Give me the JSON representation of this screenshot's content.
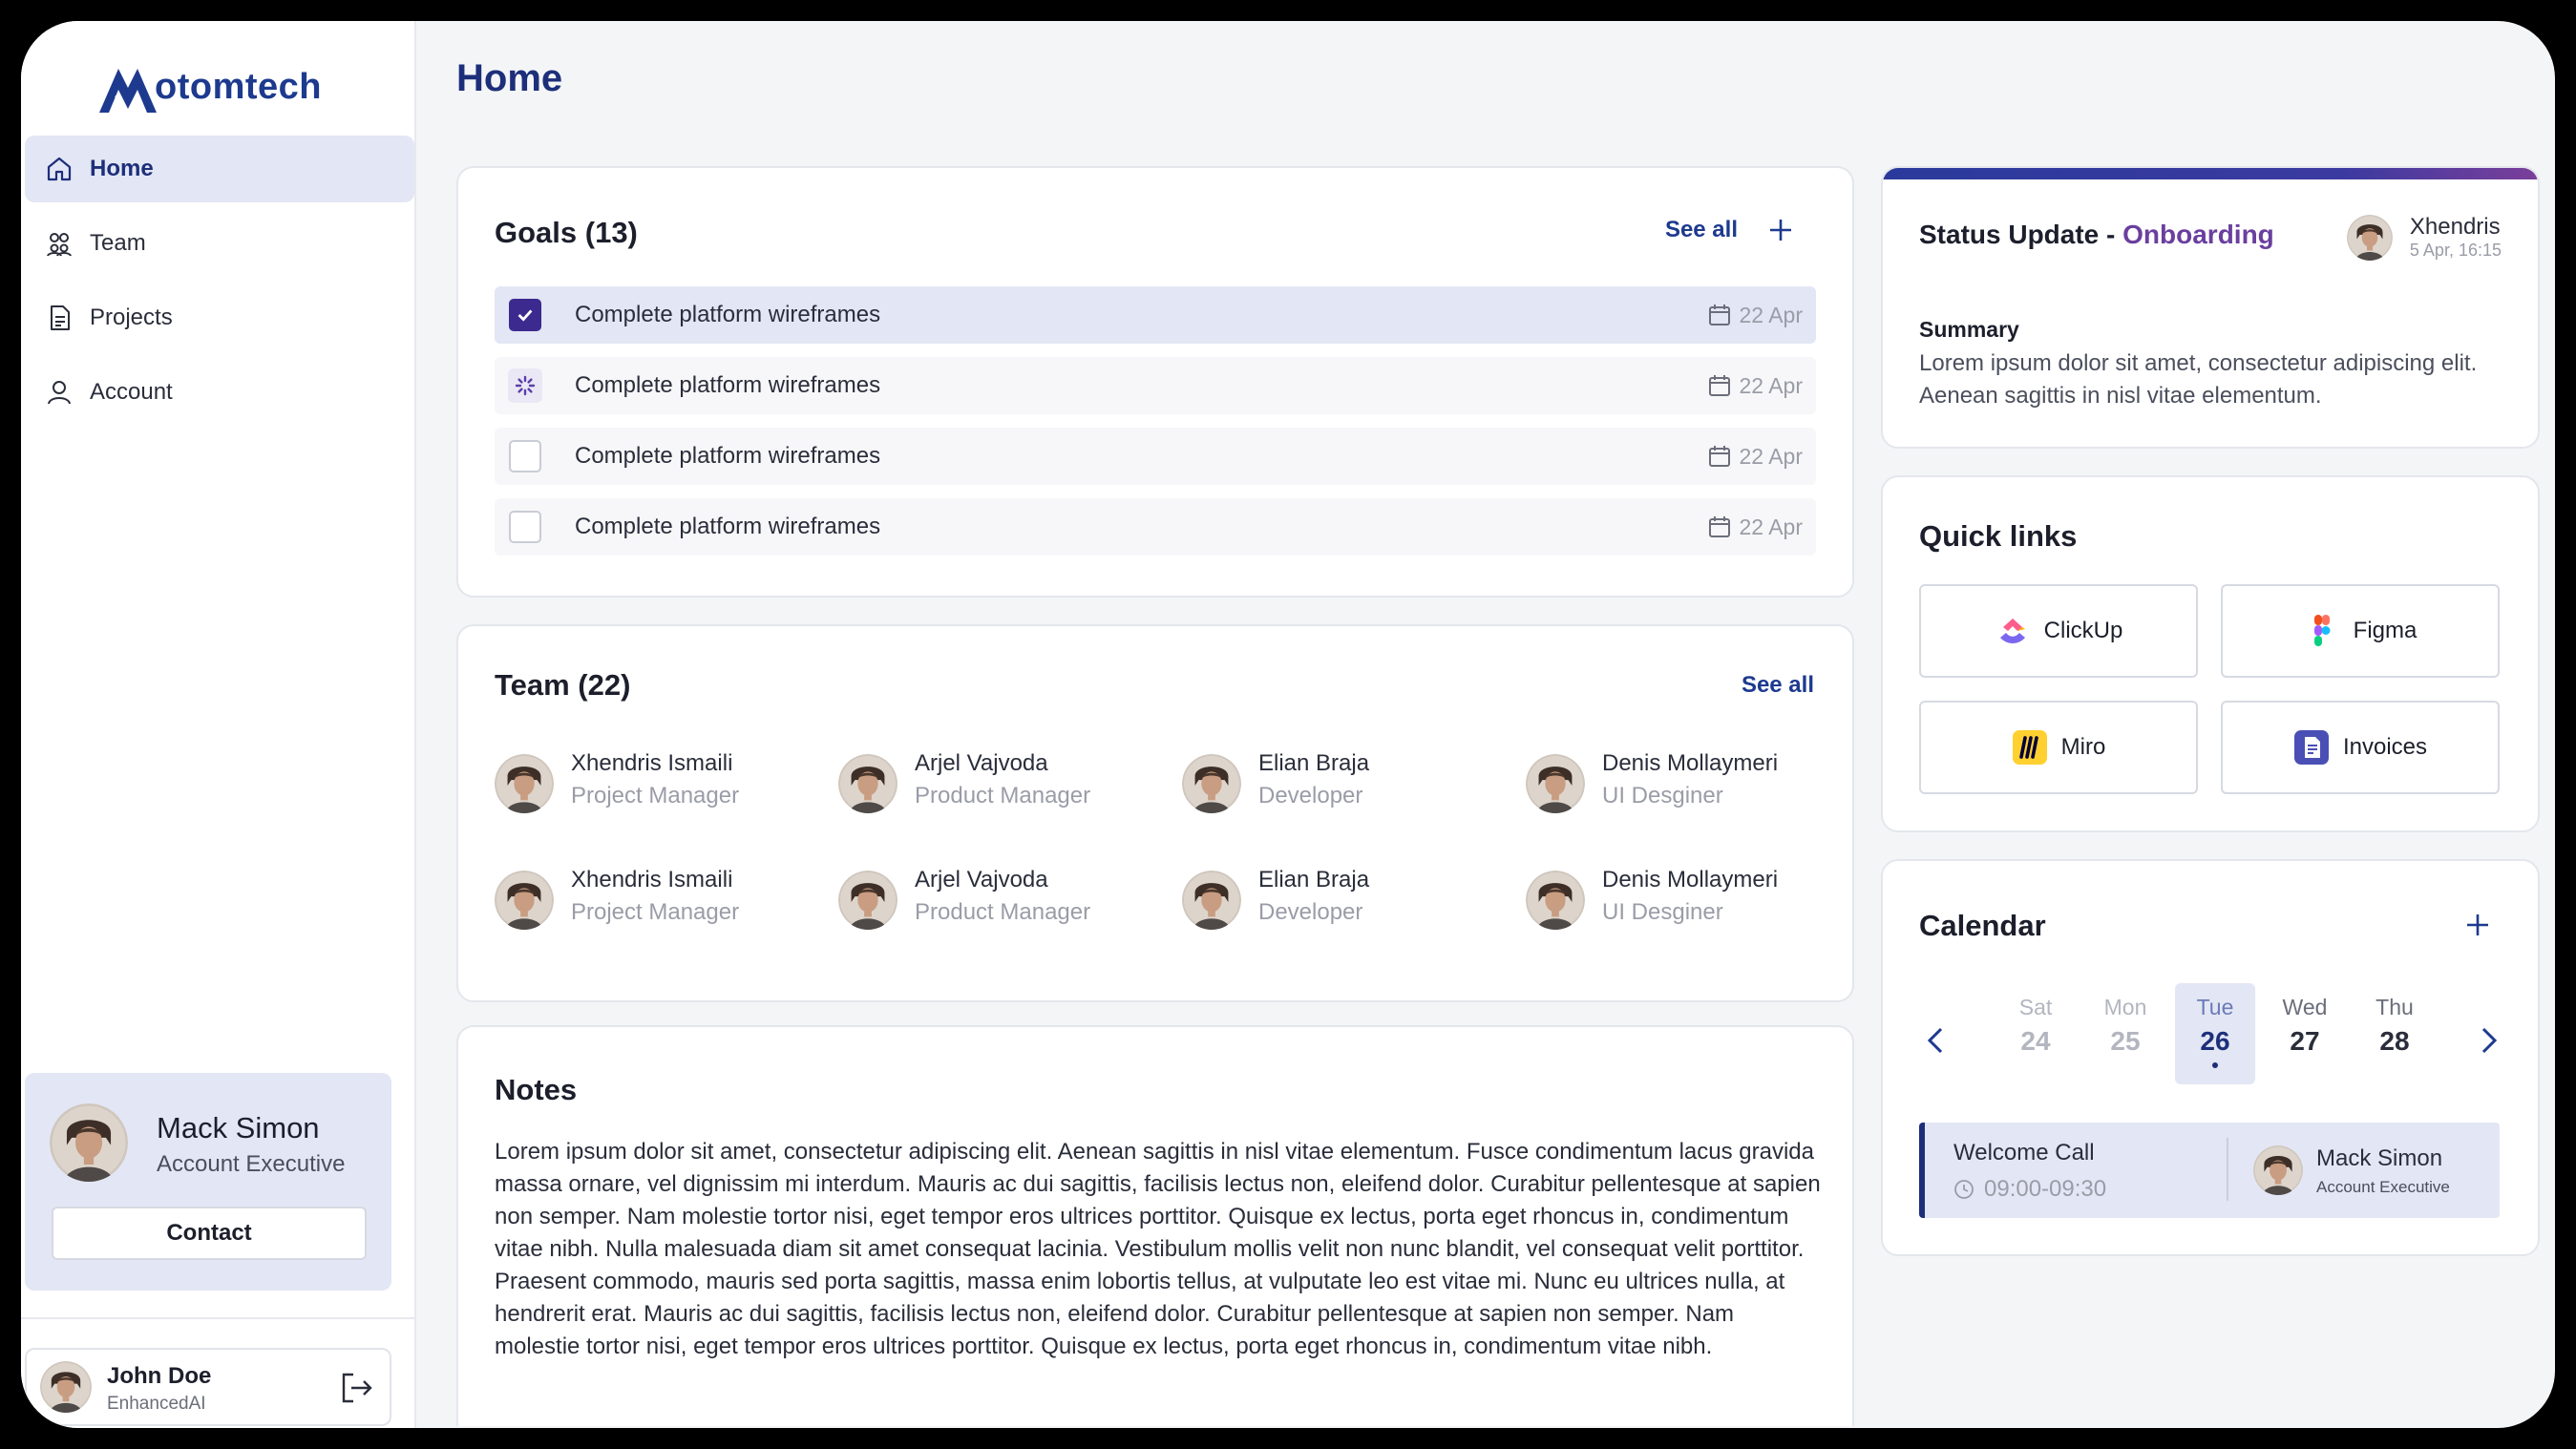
{
  "brand": {
    "name": "otomtech",
    "logo_icon": "mountain-m-logo",
    "color": "#1d3a8f"
  },
  "nav": {
    "items": [
      {
        "label": "Home",
        "icon": "home-icon",
        "active": true
      },
      {
        "label": "Team",
        "icon": "team-icon"
      },
      {
        "label": "Projects",
        "icon": "document-icon"
      },
      {
        "label": "Account",
        "icon": "user-icon"
      }
    ]
  },
  "contact_card": {
    "name": "Mack Simon",
    "role": "Account Executive",
    "button_label": "Contact"
  },
  "current_user": {
    "name": "John Doe",
    "org": "EnhancedAI"
  },
  "page": {
    "title": "Home"
  },
  "goals": {
    "title": "Goals (13)",
    "see_all": "See all",
    "items": [
      {
        "text": "Complete platform wireframes",
        "date": "22 Apr",
        "state": "checked"
      },
      {
        "text": "Complete platform wireframes",
        "date": "22 Apr",
        "state": "in-progress"
      },
      {
        "text": "Complete platform wireframes",
        "date": "22 Apr",
        "state": "unchecked"
      },
      {
        "text": "Complete platform wireframes",
        "date": "22 Apr",
        "state": "unchecked"
      }
    ]
  },
  "team": {
    "title": "Team (22)",
    "see_all": "See all",
    "members": [
      {
        "name": "Xhendris Ismaili",
        "role": "Project Manager"
      },
      {
        "name": "Arjel Vajvoda",
        "role": "Product Manager"
      },
      {
        "name": "Elian Braja",
        "role": "Developer"
      },
      {
        "name": "Denis Mollaymeri",
        "role": "UI Desginer"
      },
      {
        "name": "Xhendris Ismaili",
        "role": "Project Manager"
      },
      {
        "name": "Arjel Vajvoda",
        "role": "Product Manager"
      },
      {
        "name": "Elian Braja",
        "role": "Developer"
      },
      {
        "name": "Denis Mollaymeri",
        "role": "UI Desginer"
      }
    ]
  },
  "notes": {
    "title": "Notes",
    "body": "Lorem ipsum dolor sit amet, consectetur adipiscing elit. Aenean sagittis in nisl vitae elementum. Fusce condimentum lacus gravida massa ornare, vel dignissim mi interdum. Mauris ac dui sagittis, facilisis lectus non, eleifend dolor. Curabitur pellentesque at sapien non semper. Nam molestie tortor nisi, eget tempor eros ultrices porttitor. Quisque ex lectus, porta eget rhoncus in, condimentum vitae nibh. Nulla malesuada diam sit amet consequat lacinia. Vestibulum mollis velit non nunc blandit, vel consequat velit porttitor. Praesent commodo, mauris sed porta sagittis, massa enim lobortis tellus, at vulputate leo est vitae mi. Nunc eu ultrices nulla, at hendrerit erat. Mauris ac dui sagittis, facilisis lectus non, eleifend dolor. Curabitur pellentesque at sapien non semper. Nam molestie tortor nisi, eget tempor eros ultrices porttitor. Quisque ex lectus, porta eget rhoncus in, condimentum vitae nibh."
  },
  "status_update": {
    "title_prefix": "Status Update - ",
    "title_accent": "Onboarding",
    "author": "Xhendris",
    "timestamp": "5 Apr, 16:15",
    "summary_label": "Summary",
    "summary_text": "Lorem ipsum dolor sit amet, consectetur adipiscing elit. Aenean sagittis in nisl vitae elementum.",
    "accent_color": "#6a3f9e"
  },
  "quick_links": {
    "title": "Quick links",
    "items": [
      {
        "label": "ClickUp",
        "icon": "clickup-icon"
      },
      {
        "label": "Figma",
        "icon": "figma-icon"
      },
      {
        "label": "Miro",
        "icon": "miro-icon"
      },
      {
        "label": "Invoices",
        "icon": "invoices-icon"
      }
    ]
  },
  "calendar": {
    "title": "Calendar",
    "days": [
      {
        "name": "Sat",
        "num": "24",
        "state": "past"
      },
      {
        "name": "Mon",
        "num": "25",
        "state": "past"
      },
      {
        "name": "Tue",
        "num": "26",
        "state": "today"
      },
      {
        "name": "Wed",
        "num": "27",
        "state": "future"
      },
      {
        "name": "Thu",
        "num": "28",
        "state": "future"
      }
    ],
    "event": {
      "title": "Welcome Call",
      "time": "09:00-09:30",
      "person_name": "Mack Simon",
      "person_role": "Account Executive"
    }
  }
}
